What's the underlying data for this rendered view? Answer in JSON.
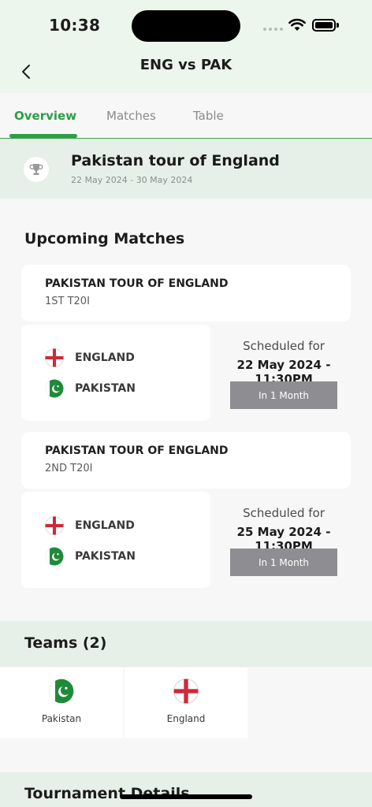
{
  "status_bar": {
    "time": "10:38"
  },
  "nav": {
    "title": "ENG vs PAK"
  },
  "tabs": [
    {
      "label": "Overview",
      "active": true
    },
    {
      "label": "Matches",
      "active": false
    },
    {
      "label": "Table",
      "active": false
    }
  ],
  "tournament": {
    "name": "Pakistan tour of England",
    "dates": "22 May 2024 - 30 May 2024"
  },
  "upcoming": {
    "title": "Upcoming Matches",
    "matches": [
      {
        "series": "PAKISTAN TOUR OF ENGLAND",
        "match_no": "1ST T20I",
        "team1": "ENGLAND",
        "team2": "PAKISTAN",
        "scheduled_label": "Scheduled for",
        "scheduled_date": "22 May 2024 - 11:30PM",
        "countdown": "In 1 Month"
      },
      {
        "series": "PAKISTAN TOUR OF ENGLAND",
        "match_no": "2ND T20I",
        "team1": "ENGLAND",
        "team2": "PAKISTAN",
        "scheduled_label": "Scheduled for",
        "scheduled_date": "25 May 2024 - 11:30PM",
        "countdown": "In 1 Month"
      }
    ]
  },
  "teams": {
    "title": "Teams (2)",
    "items": [
      {
        "name": "Pakistan",
        "flag": "pakistan-flag-icon"
      },
      {
        "name": "England",
        "flag": "england-flag-icon"
      }
    ]
  },
  "details": {
    "title": "Tournament Details"
  },
  "colors": {
    "accent": "#2e9e44",
    "band": "#e6f0e8",
    "button": "#8e8e92"
  }
}
